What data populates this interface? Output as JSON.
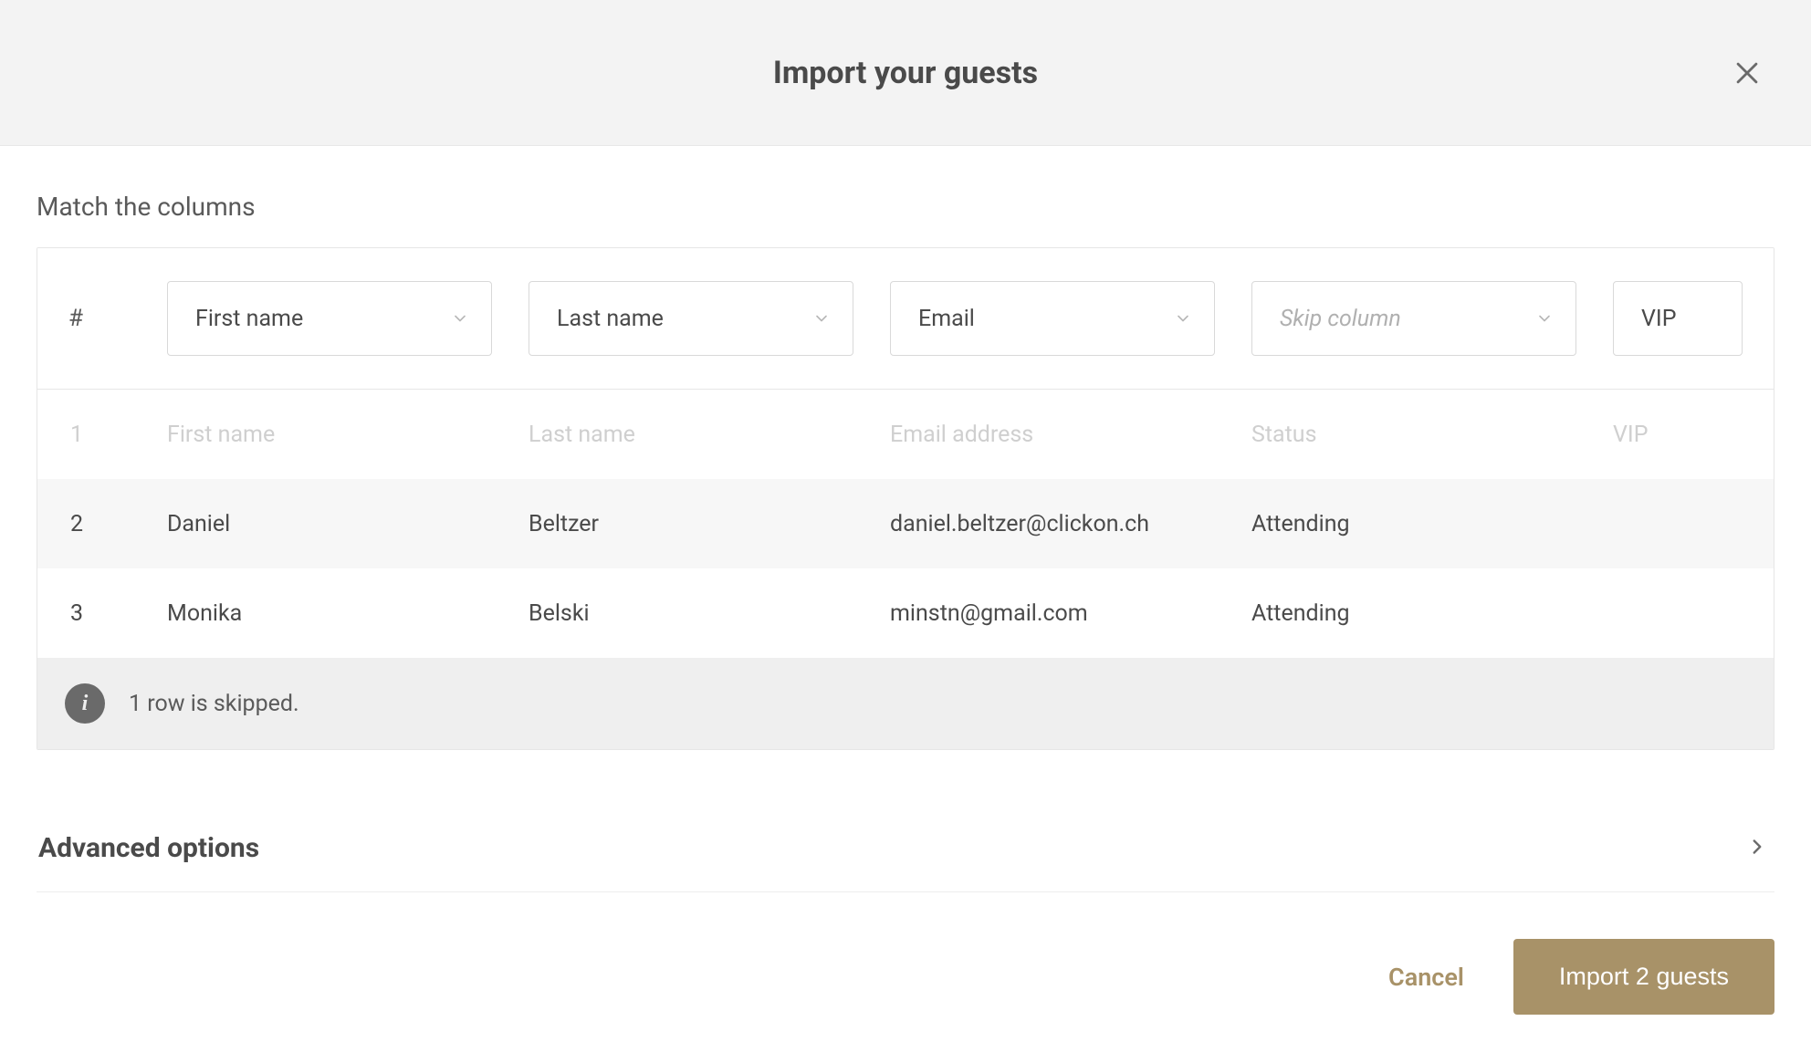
{
  "header": {
    "title": "Import your guests"
  },
  "section": {
    "match_columns_label": "Match the columns",
    "hash_label": "#"
  },
  "column_selects": [
    {
      "label": "First name",
      "placeholder": false
    },
    {
      "label": "Last name",
      "placeholder": false
    },
    {
      "label": "Email",
      "placeholder": false
    },
    {
      "label": "Skip column",
      "placeholder": true
    },
    {
      "label": "VIP",
      "placeholder": false
    }
  ],
  "header_row": {
    "num": "1",
    "first": "First name",
    "last": "Last name",
    "email": "Email address",
    "status": "Status",
    "vip": "VIP"
  },
  "data_rows": [
    {
      "num": "2",
      "first": "Daniel",
      "last": "Beltzer",
      "email": "daniel.beltzer@clickon.ch",
      "status": "Attending",
      "vip": ""
    },
    {
      "num": "3",
      "first": "Monika",
      "last": "Belski",
      "email": "minstn@gmail.com",
      "status": "Attending",
      "vip": ""
    }
  ],
  "info": {
    "text": "1 row is skipped."
  },
  "advanced": {
    "label": "Advanced options"
  },
  "footer": {
    "cancel": "Cancel",
    "import": "Import 2 guests"
  }
}
